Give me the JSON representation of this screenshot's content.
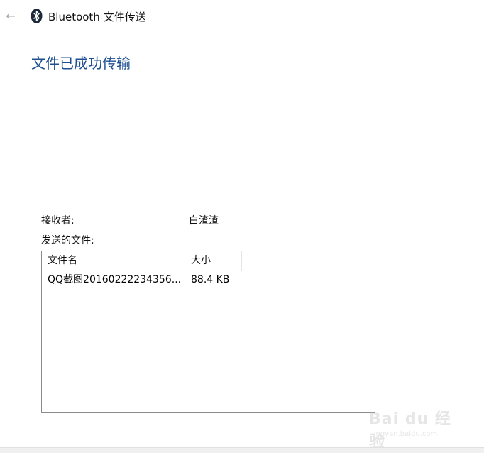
{
  "window": {
    "title": "Bluetooth 文件传送",
    "back_icon": "back-arrow-icon",
    "app_icon": "bluetooth-icon"
  },
  "main": {
    "heading": "文件已成功传输",
    "recipient_label": "接收者:",
    "recipient_value": "白渣渣",
    "files_label": "发送的文件:"
  },
  "file_table": {
    "columns": [
      "文件名",
      "大小"
    ],
    "rows": [
      {
        "name": "QQ截图20160222234356...",
        "size": "88.4 KB"
      }
    ]
  },
  "watermark": {
    "text": "Bai du 经验",
    "url": "jingyan.baidu.com"
  },
  "colors": {
    "heading": "#1d4f91",
    "bluetooth_icon": "#1c2a3a"
  }
}
